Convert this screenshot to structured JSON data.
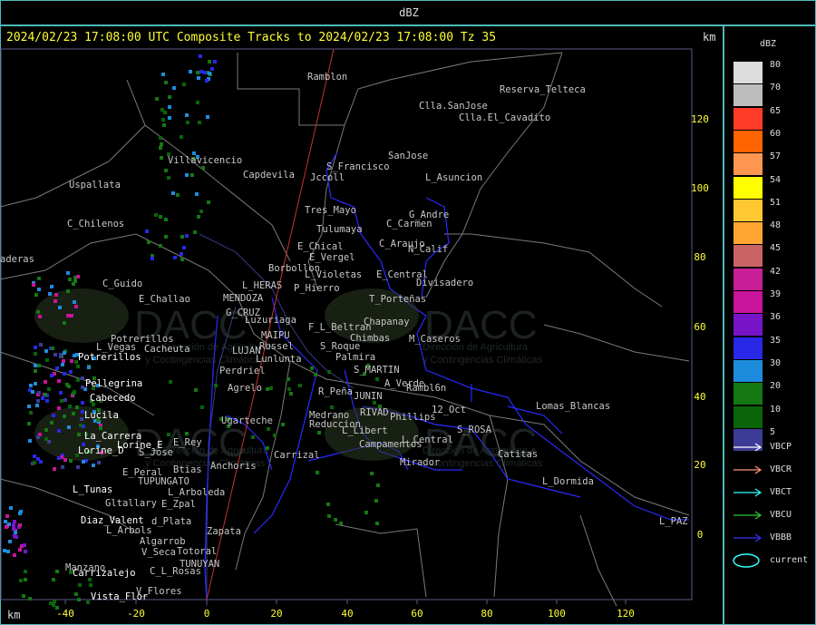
{
  "window_title": "dBZ",
  "header": "2024/02/23 17:08:00 UTC Composite Tracks to 2024/02/23 17:08:00 Tz 35",
  "unit_top": "km",
  "unit_bottom": "km",
  "x_ticks": [
    "-40",
    "-20",
    "0",
    "20",
    "40",
    "60",
    "80",
    "100",
    "120"
  ],
  "y_ticks": [
    "120",
    "100",
    "80",
    "60",
    "40",
    "20",
    "0"
  ],
  "watermark": "DACC",
  "watermark_sub1": "Dirección de Agricultura",
  "watermark_sub2": "y Contingencias Climáticas",
  "places_gray": [
    "Ramblon",
    "Reserva_Telteca",
    "Clla.SanJose",
    "Clla.El_Cavadito",
    "Villavicencio",
    "Capdevila",
    "S_Francisco",
    "Jccoll",
    "SanJose",
    "L_Asuncion",
    "Uspallata",
    "C_Chilenos",
    "Tres_Mayo",
    "G_Andre",
    "C_Carmen",
    "Tulumaya",
    "E_Chical",
    "C_Araujo",
    "N_Calif",
    "E_Vergel",
    "aderas",
    "Borbollon",
    "L_Violetas",
    "E_Central",
    "Divisadero",
    "C_Guido",
    "L_HERAS",
    "P_Hierro",
    "E_Challao",
    "MENDOZA",
    "T_Porteñas",
    "G_CRUZ",
    "Luzuriaga",
    "F_L_Beltran",
    "Chapanay",
    "MAIPU",
    "Potrerillos",
    "Chimbas",
    "M_Caseros",
    "L_Vegas",
    "Cacheuta",
    "Russel",
    "S_Roque",
    "LUJAN",
    "Lunlunta",
    "Palmira",
    "Perdriel",
    "S_MARTIN",
    "Agrelo",
    "A_Verde",
    "R_Peña",
    "Rambl6n",
    "JUNIN",
    "Lomas_Blancas",
    "RIVAD",
    "12_Oct",
    "Medrano",
    "Phillips",
    "Ugarteche",
    "Reduccion",
    "S_ROSA",
    "L_Libert",
    "L_Central",
    "Campamentos",
    "E_Rey",
    "S_Jose",
    "Carrizal",
    "Catitas",
    "Mirador",
    "E_Peral",
    "Btias",
    "Anchoris",
    "L_Dormida",
    "TUPUNGATO",
    "L_Arboleda",
    "Gltallary",
    "E_Zpal",
    "d_Plata",
    "L_PAZ",
    "L_Arbols",
    "Zapata",
    "Algarrob",
    "V_Seca",
    "Totoral",
    "TUNUYAN",
    "Manzano",
    "C_L_Rosas",
    "V_Flores"
  ],
  "places_white": [
    "Potrerillos",
    "Pellegrina",
    "Cabecedo",
    "Lucila",
    "La_Carrera",
    "Lorine_E",
    "Lorine_D",
    "L_Tunas",
    "Diaz_Valent",
    "Carrizalejo",
    "Vista_Flor"
  ],
  "legend": {
    "title": "dBZ",
    "values": [
      "80",
      "70",
      "65",
      "60",
      "57",
      "54",
      "51",
      "48",
      "45",
      "42",
      "39",
      "36",
      "35",
      "30",
      "20",
      "10",
      "5"
    ],
    "colors": [
      "#dcdcdc",
      "#bdbdbd",
      "#ff3c28",
      "#ff6400",
      "#ff9650",
      "#ffff00",
      "#ffc832",
      "#ffa532",
      "#c86464",
      "#c81e96",
      "#c8149a",
      "#7814c8",
      "#2828e6",
      "#1e8cdc",
      "#147814",
      "#0a640a",
      "#3c3c96"
    ],
    "tracks": [
      {
        "label": "VBCP",
        "color": "#ffffff"
      },
      {
        "label": "VBCR",
        "color": "#ff9678"
      },
      {
        "label": "VBCT",
        "color": "#32ffff"
      },
      {
        "label": "VBCU",
        "color": "#32c832"
      },
      {
        "label": "VBBB",
        "color": "#3232ff"
      }
    ],
    "current_label": "current",
    "current_color": "#32ffff"
  }
}
